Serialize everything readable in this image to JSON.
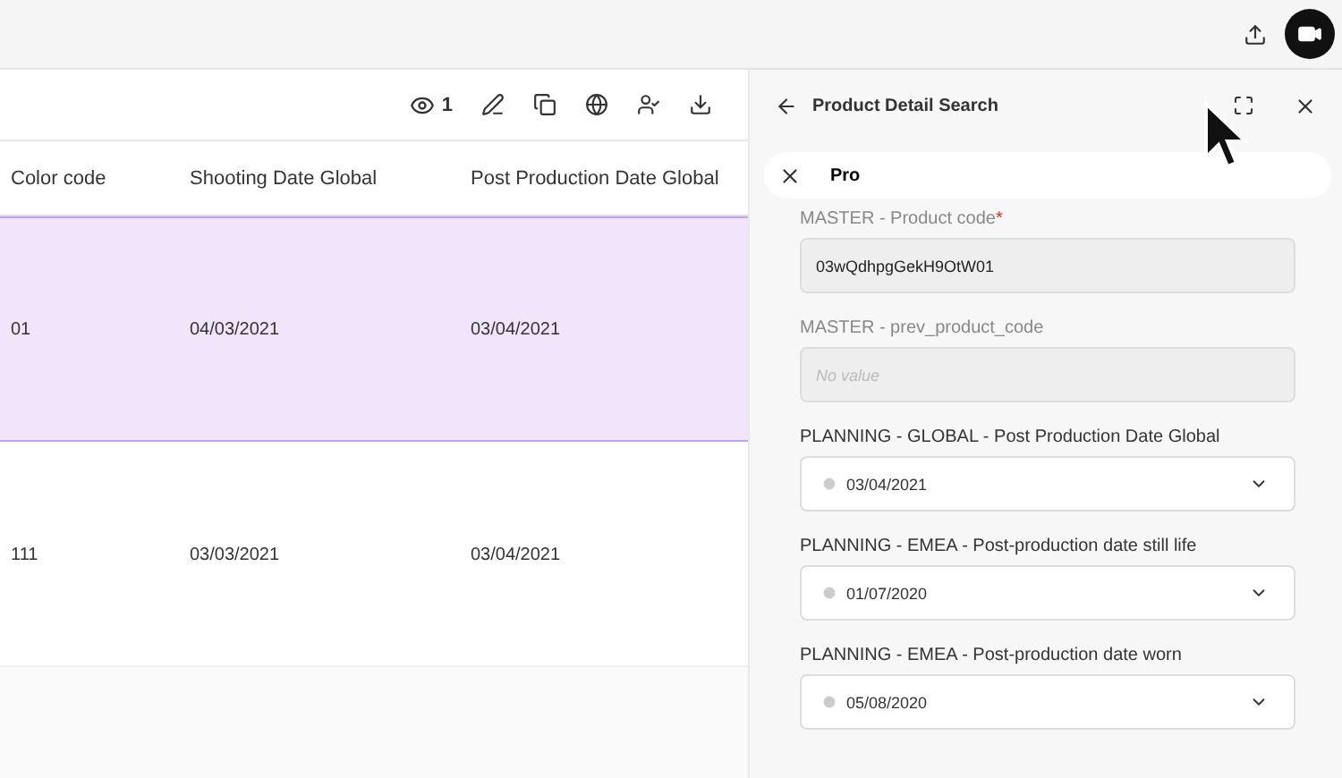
{
  "toolbar": {
    "view_count": "1"
  },
  "table": {
    "columns": [
      "Color code",
      "Shooting Date Global",
      "Post Production Date Global"
    ],
    "rows": [
      {
        "cells": [
          "01",
          "04/03/2021",
          "03/04/2021"
        ],
        "selected": true
      },
      {
        "cells": [
          "111",
          "03/03/2021",
          "03/04/2021"
        ],
        "selected": false
      }
    ]
  },
  "panel": {
    "title": "Product Detail Search",
    "search": {
      "value": "Pro"
    },
    "fields": [
      {
        "kind": "text",
        "label": "MASTER - Product code",
        "required_mark": "*",
        "value": "03wQdhpgGekH9OtW01",
        "disabled": true
      },
      {
        "kind": "text",
        "label": "MASTER - prev_product_code",
        "placeholder": "No value",
        "disabled": true
      },
      {
        "kind": "date",
        "label": "PLANNING - GLOBAL - Post Production Date Global",
        "value": "03/04/2021"
      },
      {
        "kind": "date",
        "label": "PLANNING - EMEA - Post-production date still life",
        "value": "01/07/2020"
      },
      {
        "kind": "date",
        "label": "PLANNING - EMEA - Post-production date worn",
        "value": "05/08/2020"
      }
    ]
  }
}
